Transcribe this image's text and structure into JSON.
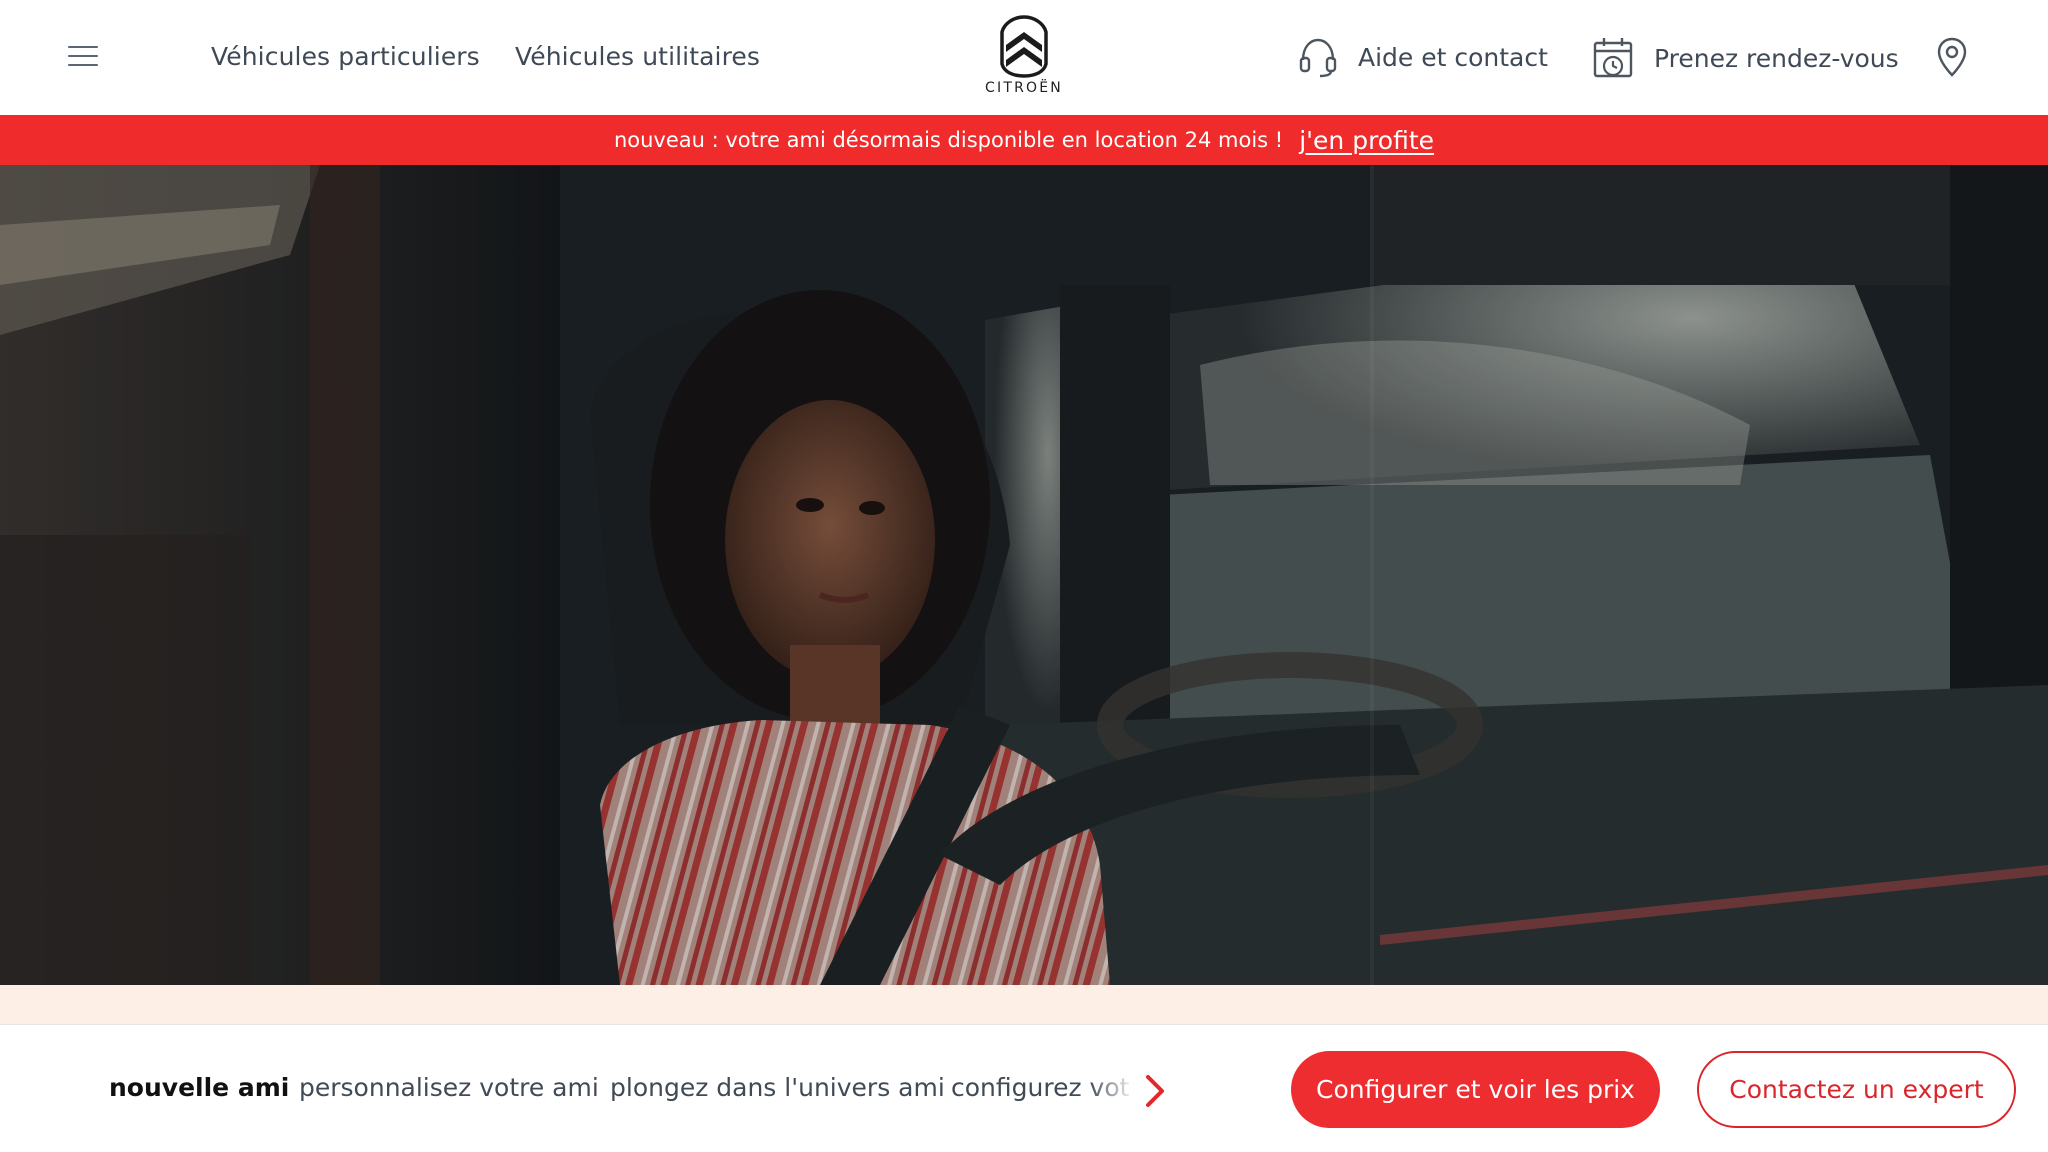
{
  "header": {
    "menu_icon": "hamburger-menu-icon",
    "nav": {
      "particuliers": "Véhicules particuliers",
      "utilitaires": "Véhicules utilitaires"
    },
    "logo_text": "CITROËN",
    "help": {
      "icon": "headset-icon",
      "label": "Aide et contact"
    },
    "appointment": {
      "icon": "calendar-clock-icon",
      "label": "Prenez rendez-vous"
    },
    "locator_icon": "map-pin-icon"
  },
  "promo": {
    "text": "nouveau : votre ami désormais disponible en location 24 mois !",
    "link": "j'en profite",
    "background": "#f02b2b"
  },
  "bottom_bar": {
    "anchors": [
      {
        "label": "nouvelle ami",
        "active": true
      },
      {
        "label": "personnalisez votre ami",
        "active": false
      },
      {
        "label": "plongez dans l'univers ami",
        "active": false
      },
      {
        "label": "configurez votre ami",
        "active": false
      }
    ],
    "next_icon": "chevron-right-icon",
    "cta_primary": "Configurer et voir les prix",
    "cta_secondary": "Contactez un expert"
  },
  "colors": {
    "brand_red": "#ed2d30",
    "text": "#414b56",
    "cream": "#fdefe6"
  }
}
